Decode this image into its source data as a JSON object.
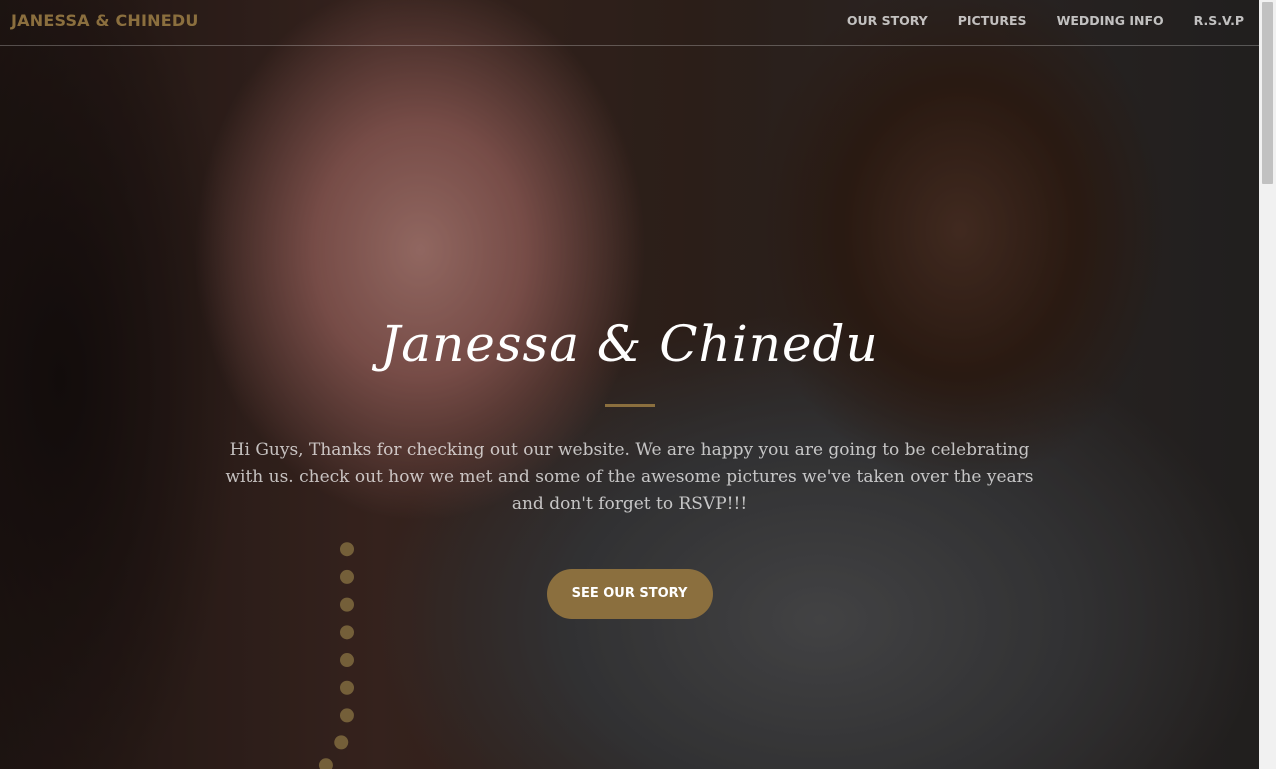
{
  "brand": "JANESSA & CHINEDU",
  "nav": {
    "items": [
      "OUR STORY",
      "PICTURES",
      "WEDDING INFO",
      "R.S.V.P"
    ]
  },
  "hero": {
    "title": "Janessa & Chinedu",
    "text": "Hi Guys, Thanks for checking out our website. We are happy you are going to be celebrating with us. check out how we met and some of the awesome pictures we've taken over the years and don't forget to RSVP!!!",
    "cta": "SEE OUR STORY",
    "background_image": "couple-selfie-photo"
  },
  "colors": {
    "accent": "#8b6f3e",
    "text_light": "#ffffff"
  }
}
